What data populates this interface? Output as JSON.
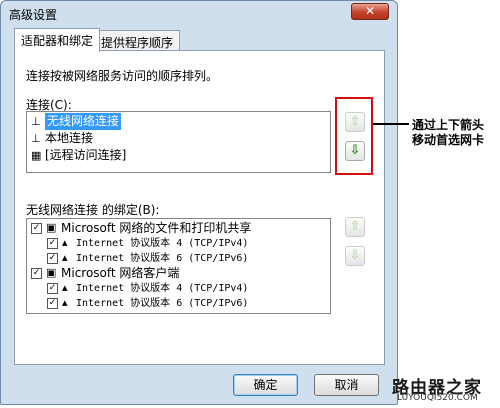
{
  "window": {
    "title": "高级设置",
    "close_glyph": "✕"
  },
  "tabs": [
    {
      "label": "适配器和绑定"
    },
    {
      "label": "提供程序顺序"
    }
  ],
  "description": "连接按被网络服务访问的顺序排列。",
  "connections": {
    "label": "连接(C):",
    "items": [
      {
        "label": "无线网络连接",
        "selected": true
      },
      {
        "label": "本地连接",
        "selected": false
      },
      {
        "label": "[远程访问连接]",
        "selected": false
      }
    ],
    "move_up_glyph": "⇧",
    "move_down_glyph": "⇩"
  },
  "annotation": {
    "line1": "通过上下箭头",
    "line2": "移动首选网卡"
  },
  "bindings": {
    "label": "无线网络连接 的绑定(B):",
    "items": [
      {
        "label": "Microsoft 网络的文件和打印机共享",
        "checked": true,
        "level": 0
      },
      {
        "label": "Internet 协议版本 4 (TCP/IPv4)",
        "checked": true,
        "level": 1
      },
      {
        "label": "Internet 协议版本 6 (TCP/IPv6)",
        "checked": true,
        "level": 1
      },
      {
        "label": "Microsoft 网络客户端",
        "checked": true,
        "level": 0
      },
      {
        "label": "Internet 协议版本 4 (TCP/IPv4)",
        "checked": true,
        "level": 1
      },
      {
        "label": "Internet 协议版本 6 (TCP/IPv6)",
        "checked": true,
        "level": 1
      }
    ]
  },
  "buttons": {
    "ok": "确定",
    "cancel": "取消"
  },
  "watermark": {
    "name": "路由器之家",
    "url": "LUYOUQI520.COM"
  },
  "colors": {
    "selection": "#3399ff",
    "highlight_box": "#d01010",
    "arrow_enabled": "#2d8d1c"
  }
}
